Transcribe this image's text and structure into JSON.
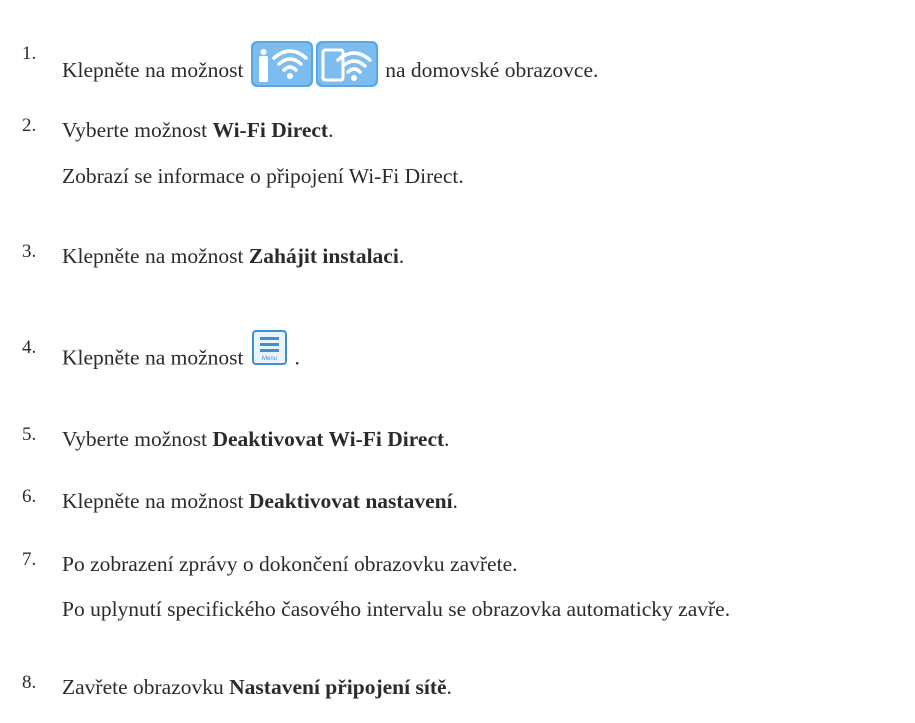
{
  "steps": [
    {
      "number": "1.",
      "lines": [
        {
          "before": "Klepněte na možnost",
          "after": "na domovské obrazovce."
        }
      ],
      "icon": "wifi-direct-icons"
    },
    {
      "number": "2.",
      "lines": [
        {
          "before": "Vyberte možnost",
          "bold": "Wi-Fi Direct",
          "after": "."
        },
        {
          "text": "Zobrazí se informace o připojení Wi-Fi Direct."
        }
      ]
    },
    {
      "number": "3.",
      "lines": [
        {
          "before": "Klepněte na možnost",
          "bold": "Zahájit instalaci",
          "after": "."
        }
      ]
    },
    {
      "number": "4.",
      "lines": [
        {
          "before": "Klepněte na možnost",
          "after": "."
        }
      ],
      "icon": "menu-icon",
      "icon_label": "Menu"
    },
    {
      "number": "5.",
      "lines": [
        {
          "before": "Vyberte možnost",
          "bold": "Deaktivovat Wi-Fi Direct",
          "after": "."
        }
      ]
    },
    {
      "number": "6.",
      "lines": [
        {
          "before": "Klepněte na možnost",
          "bold": "Deaktivovat nastavení",
          "after": "."
        }
      ]
    },
    {
      "number": "7.",
      "lines": [
        {
          "text": "Po zobrazení zprávy o dokončení obrazovku zavřete."
        },
        {
          "text": "Po uplynutí specifického časového intervalu se obrazovka automaticky zavře."
        }
      ]
    },
    {
      "number": "8.",
      "lines": [
        {
          "before": "Zavřete obrazovku",
          "bold": "Nastavení připojení sítě",
          "after": "."
        }
      ]
    }
  ],
  "colors": {
    "text": "#2b2b2b",
    "icon_blue": "#3d8fd6",
    "icon_bg": "#6fb3ea"
  }
}
